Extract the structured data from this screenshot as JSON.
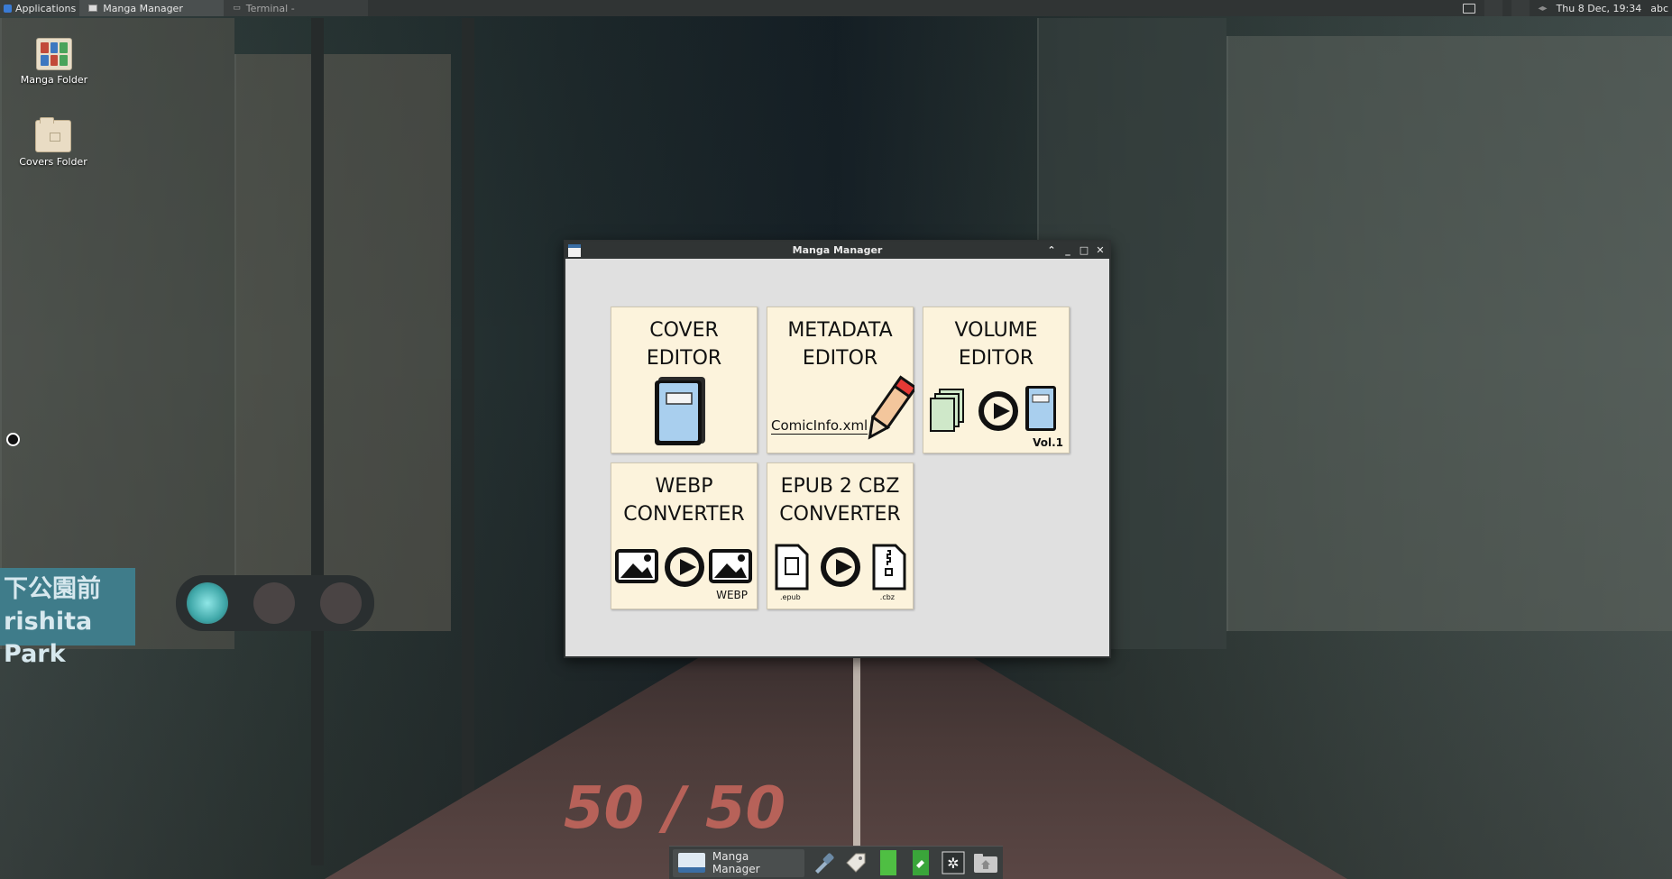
{
  "top_panel": {
    "applications_label": "Applications",
    "tasks": [
      {
        "title": "Manga Manager"
      },
      {
        "title": "Terminal -"
      }
    ],
    "clock": "Thu  8 Dec, 19:34",
    "keyboard": "abc"
  },
  "desktop_icons": [
    {
      "label": "Manga Folder"
    },
    {
      "label": "Covers Folder"
    }
  ],
  "background": {
    "road_text": "50 / 50",
    "sign_line1": "下公園前",
    "sign_line2": "rishita Park"
  },
  "window": {
    "title": "Manga Manager",
    "controls": {
      "shade": "⌃",
      "minimize": "_",
      "maximize": "□",
      "close": "✕"
    },
    "tiles": [
      {
        "line1": "COVER",
        "line2": "EDITOR"
      },
      {
        "line1": "METADATA",
        "line2": "EDITOR",
        "caption": "ComicInfo.xml"
      },
      {
        "line1": "VOLUME",
        "line2": "EDITOR",
        "caption": "Vol.1"
      },
      {
        "line1": "WEBP",
        "line2": "CONVERTER",
        "caption": "WEBP"
      },
      {
        "line1": "EPUB 2 CBZ",
        "line2": "CONVERTER",
        "epub_caption": ".epub",
        "cbz_caption": ".cbz"
      }
    ]
  },
  "dock": {
    "active_app": "Manga Manager",
    "icons": [
      "color-picker-icon",
      "tag-icon",
      "green-book-icon",
      "green-edit-icon",
      "settings-icon",
      "home-folder-icon"
    ]
  },
  "colors": {
    "tile_bg": "#fcf3dc",
    "window_bg": "#e0e0e0",
    "panel_bg": "#303434",
    "accent": "#3a6ea5"
  }
}
